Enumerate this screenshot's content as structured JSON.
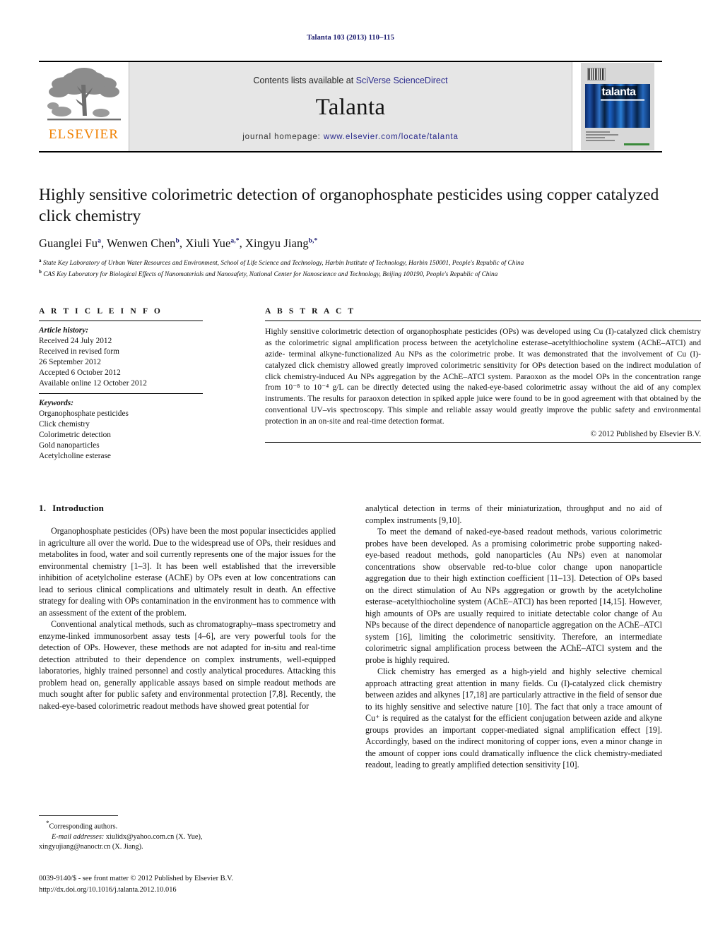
{
  "running_head": "Talanta 103 (2013) 110–115",
  "masthead": {
    "contents_prefix": "Contents lists available at ",
    "sciencedirect": "SciVerse ScienceDirect",
    "journal_name": "Talanta",
    "homepage_prefix": "journal homepage: ",
    "homepage_url": "www.elsevier.com/locate/talanta",
    "publisher_wordmark": "ELSEVIER",
    "publisher_logo_icon": "elsevier-tree-icon",
    "cover_title": "talanta",
    "link_color": "#2a2a8c",
    "brand_orange": "#F08000"
  },
  "title": "Highly sensitive colorimetric detection of organophosphate pesticides using copper catalyzed click chemistry",
  "authors": [
    {
      "name": "Guanglei Fu",
      "marks": "a"
    },
    {
      "name": "Wenwen Chen",
      "marks": "b"
    },
    {
      "name": "Xiuli Yue",
      "marks": "a,*"
    },
    {
      "name": "Xingyu Jiang",
      "marks": "b,*"
    }
  ],
  "affiliations": [
    {
      "mark": "a",
      "text": "State Key Laboratory of Urban Water Resources and Environment, School of Life Science and Technology, Harbin Institute of Technology, Harbin 150001, People's Republic of China"
    },
    {
      "mark": "b",
      "text": "CAS Key Laboratory for Biological Effects of Nanomaterials and Nanosafety, National Center for Nanoscience and Technology, Beijing 100190, People's Republic of China"
    }
  ],
  "article_info": {
    "heading": "A R T I C L E   I N F O",
    "history_label": "Article history:",
    "history": [
      "Received 24 July 2012",
      "Received in revised form",
      "26 September 2012",
      "Accepted 6 October 2012",
      "Available online 12 October 2012"
    ],
    "keywords_label": "Keywords:",
    "keywords": [
      "Organophosphate pesticides",
      "Click chemistry",
      "Colorimetric detection",
      "Gold nanoparticles",
      "Acetylcholine esterase"
    ]
  },
  "abstract": {
    "heading": "A B S T R A C T",
    "text": "Highly sensitive colorimetric detection of organophosphate pesticides (OPs) was developed using Cu (I)-catalyzed click chemistry as the colorimetric signal amplification process between the acetylcholine esterase–acetylthiocholine system (AChE–ATCl) and azide- terminal alkyne-functionalized Au NPs as the colorimetric probe. It was demonstrated that the involvement of Cu (I)-catalyzed click chemistry allowed greatly improved colorimetric sensitivity for OPs detection based on the indirect modulation of click chemistry-induced Au NPs aggregation by the AChE–ATCl system. Paraoxon as the model OPs in the concentration range from 10⁻⁸ to 10⁻⁴ g/L can be directly detected using the naked-eye-based colorimetric assay without the aid of any complex instruments. The results for paraoxon detection in spiked apple juice were found to be in good agreement with that obtained by the conventional UV–vis spectroscopy. This simple and reliable assay would greatly improve the public safety and environmental protection in an on-site and real-time detection format.",
    "copyright": "© 2012 Published by Elsevier B.V."
  },
  "sections": {
    "intro_number": "1.",
    "intro_title": "Introduction"
  },
  "body": {
    "left": [
      "Organophosphate pesticides (OPs) have been the most popular insecticides applied in agriculture all over the world. Due to the widespread use of OPs, their residues and metabolites in food, water and soil currently represents one of the major issues for the environmental chemistry [1–3]. It has been well established that the irreversible inhibition of acetylcholine esterase (AChE) by OPs even at low concentrations can lead to serious clinical complications and ultimately result in death. An effective strategy for dealing with OPs contamination in the environment has to commence with an assessment of the extent of the problem.",
      "Conventional analytical methods, such as chromatography–mass spectrometry and enzyme-linked immunosorbent assay tests [4–6], are very powerful tools for the detection of OPs. However, these methods are not adapted for in-situ and real-time detection attributed to their dependence on complex instruments, well-equipped laboratories, highly trained personnel and costly analytical procedures. Attacking this problem head on, generally applicable assays based on simple readout methods are much sought after for public safety and environmental protection [7,8]. Recently, the naked-eye-based colorimetric readout methods have showed great potential for"
    ],
    "right": [
      "analytical detection in terms of their miniaturization, throughput and no aid of complex instruments [9,10].",
      "To meet the demand of naked-eye-based readout methods, various colorimetric probes have been developed. As a promising colorimetric probe supporting naked-eye-based readout methods, gold nanoparticles (Au NPs) even at nanomolar concentrations show observable red-to-blue color change upon nanoparticle aggregation due to their high extinction coefficient [11–13]. Detection of OPs based on the direct stimulation of Au NPs aggregation or growth by the acetylcholine esterase–acetylthiocholine system (AChE–ATCl) has been reported [14,15]. However, high amounts of OPs are usually required to initiate detectable color change of Au NPs because of the direct dependence of nanoparticle aggregation on the AChE–ATCl system [16], limiting the colorimetric sensitivity. Therefore, an intermediate colorimetric signal amplification process between the AChE–ATCl system and the probe is highly required.",
      "Click chemistry has emerged as a high-yield and highly selective chemical approach attracting great attention in many fields. Cu (I)-catalyzed click chemistry between azides and alkynes [17,18] are particularly attractive in the field of sensor due to its highly sensitive and selective nature [10]. The fact that only a trace amount of Cu⁺ is required as the catalyst for the efficient conjugation between azide and alkyne groups provides an important copper-mediated signal amplification effect [19]. Accordingly, based on the indirect monitoring of copper ions, even a minor change in the amount of copper ions could dramatically influence the click chemistry-mediated readout, leading to greatly amplified detection sensitivity [10]."
    ]
  },
  "footnote": {
    "corresponding": "Corresponding authors.",
    "email_label": "E-mail addresses:",
    "email_line1": " xiulidx@yahoo.com.cn (X. Yue),",
    "email_line2": "xingyujiang@nanoctr.cn (X. Jiang)."
  },
  "footer": {
    "line1": "0039-9140/$ - see front matter © 2012 Published by Elsevier B.V.",
    "line2": "http://dx.doi.org/10.1016/j.talanta.2012.10.016"
  }
}
